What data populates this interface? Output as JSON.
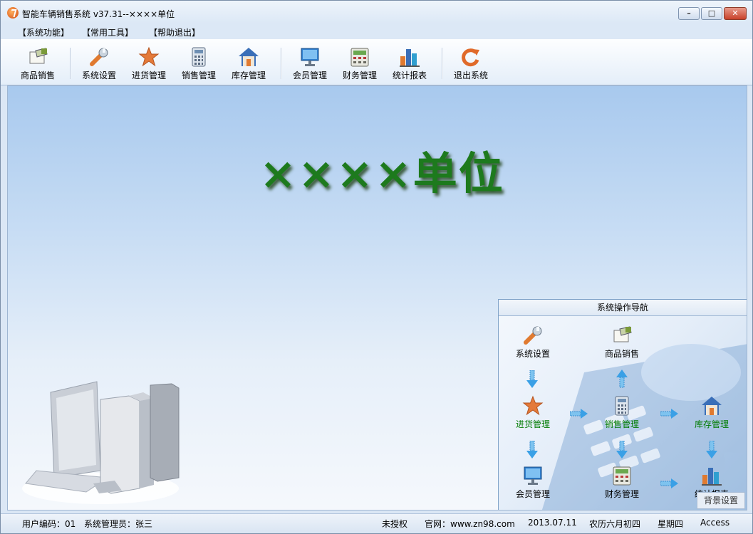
{
  "window": {
    "title": "智能车辆销售系统 v37.31--××××单位"
  },
  "menu": [
    {
      "label": "【系统功能】"
    },
    {
      "label": "【常用工具】"
    },
    {
      "label": "【帮助退出】"
    }
  ],
  "toolbar": [
    {
      "label": "商品销售",
      "icon": "hand-card-icon"
    },
    {
      "label": "系统设置",
      "icon": "wrench-icon"
    },
    {
      "label": "进货管理",
      "icon": "star-icon"
    },
    {
      "label": "销售管理",
      "icon": "calculator-icon"
    },
    {
      "label": "库存管理",
      "icon": "house-icon"
    },
    {
      "label": "会员管理",
      "icon": "monitor-icon"
    },
    {
      "label": "财务管理",
      "icon": "cash-register-icon"
    },
    {
      "label": "统计报表",
      "icon": "bar-chart-icon"
    },
    {
      "label": "退出系统",
      "icon": "refresh-icon"
    }
  ],
  "main": {
    "headline": "××××单位"
  },
  "nav": {
    "title": "系统操作导航",
    "nodes": [
      {
        "label": "系统设置",
        "icon": "wrench-icon"
      },
      {
        "label": "商品销售",
        "icon": "hand-card-icon"
      },
      {
        "label": "进货管理",
        "icon": "star-icon"
      },
      {
        "label": "销售管理",
        "icon": "calculator-icon"
      },
      {
        "label": "库存管理",
        "icon": "house-icon"
      },
      {
        "label": "会员管理",
        "icon": "monitor-icon"
      },
      {
        "label": "财务管理",
        "icon": "cash-register-icon"
      },
      {
        "label": "统计报表",
        "icon": "bar-chart-icon"
      }
    ],
    "bg_button": "背景设置"
  },
  "status": {
    "user_code": "用户编码：01",
    "admin": "系统管理员：张三",
    "license": "未授权",
    "website": "官网：www.zn98.com",
    "date": "2013.07.11",
    "lunar": "农历六月初四",
    "weekday": "星期四",
    "db": "Access"
  },
  "colors": {
    "headline": "#1d7a1d",
    "nav_green": "#007b00"
  }
}
